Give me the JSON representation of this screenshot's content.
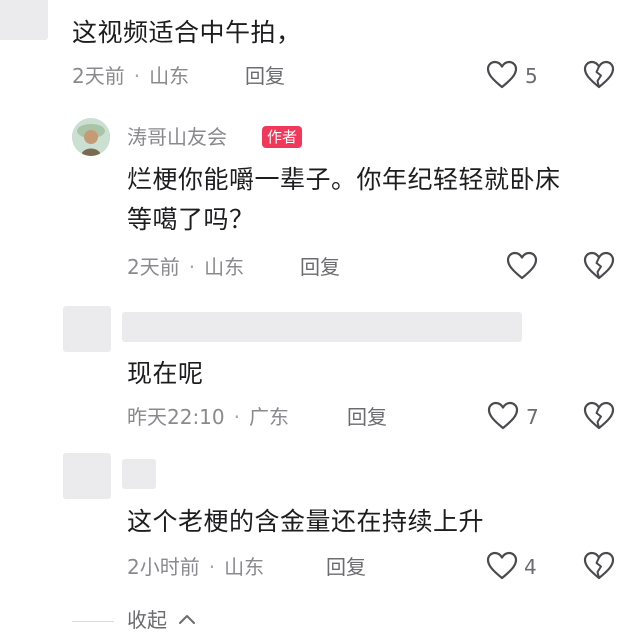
{
  "comments": [
    {
      "text": "这视频适合中午拍，",
      "time": "2天前",
      "location": "山东",
      "reply_label": "回复",
      "likes": "5"
    },
    {
      "username": "涛哥山友会",
      "badge": "作者",
      "text_line1": "烂梗你能嚼一辈子。你年纪轻轻就卧床",
      "text_line2": "等噶了吗？",
      "time": "2天前",
      "location": "山东",
      "reply_label": "回复"
    },
    {
      "text": "现在呢",
      "time": "昨天22:10",
      "location": "广东",
      "reply_label": "回复",
      "likes": "7"
    },
    {
      "text": "这个老梗的含金量还在持续上升",
      "time": "2小时前",
      "location": "山东",
      "reply_label": "回复",
      "likes": "4"
    }
  ],
  "separator": "·",
  "collapse_label": "收起",
  "icons": {
    "like": "heart-outline-icon",
    "dislike": "broken-heart-icon",
    "collapse": "chevron-up-icon"
  },
  "colors": {
    "badge": "#f2385a",
    "meta": "#8a8a8e",
    "placeholder": "#ebebed"
  }
}
